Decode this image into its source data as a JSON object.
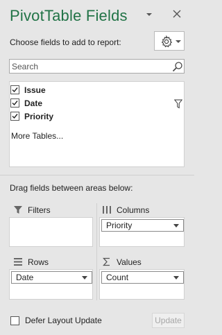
{
  "pane": {
    "title": "PivotTable Fields",
    "accent_color": "#217346",
    "title_icons": [
      "task-pane-options-icon",
      "close-icon"
    ]
  },
  "choose": {
    "label": "Choose fields to add to report:",
    "tools_icon": "gear-icon"
  },
  "search": {
    "placeholder": "Search",
    "value": "",
    "icon": "search-icon"
  },
  "fields": [
    {
      "name": "Issue",
      "checked": true,
      "filtered": false
    },
    {
      "name": "Date",
      "checked": true,
      "filtered": true
    },
    {
      "name": "Priority",
      "checked": true,
      "filtered": false
    }
  ],
  "more_tables": "More Tables...",
  "areas": {
    "instruction": "Drag fields between areas below:",
    "filters": {
      "label": "Filters",
      "icon": "filter-area-icon",
      "fields": []
    },
    "columns": {
      "label": "Columns",
      "icon": "columns-area-icon",
      "fields": [
        "Priority"
      ]
    },
    "rows": {
      "label": "Rows",
      "icon": "rows-area-icon",
      "fields": [
        "Date"
      ]
    },
    "values": {
      "label": "Values",
      "icon": "sigma-icon",
      "fields": [
        "Count"
      ]
    }
  },
  "footer": {
    "defer_label": "Defer Layout Update",
    "defer_checked": false,
    "update_label": "Update",
    "update_enabled": false
  }
}
